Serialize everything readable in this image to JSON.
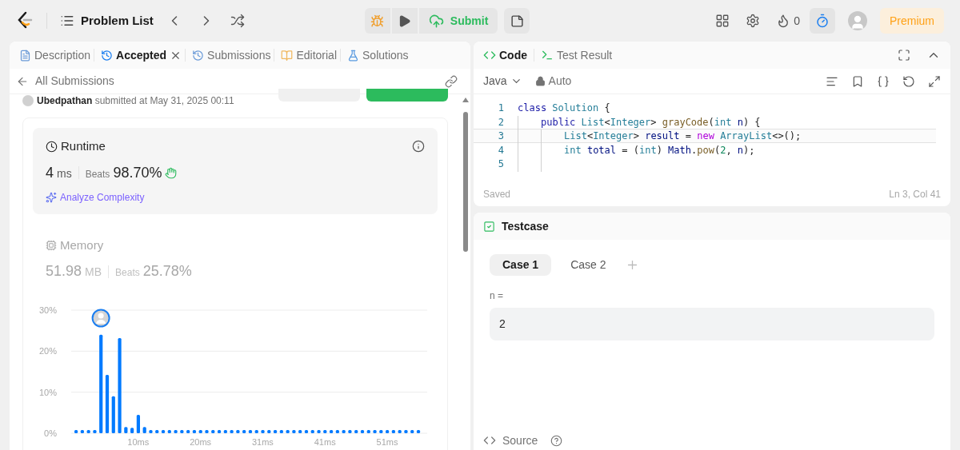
{
  "toolbar": {
    "title": "Problem List",
    "submit_label": "Submit",
    "streak": "0",
    "premium": "Premium",
    "timer_active": true
  },
  "left_tabs": [
    {
      "label": "Description",
      "selected": false,
      "closable": false
    },
    {
      "label": "Accepted",
      "selected": true,
      "closable": true
    },
    {
      "label": "Submissions",
      "selected": false,
      "closable": false
    },
    {
      "label": "Editorial",
      "selected": false,
      "closable": false
    },
    {
      "label": "Solutions",
      "selected": false,
      "closable": false
    }
  ],
  "submission": {
    "back_label": "All Submissions",
    "user": "Ubedpathan",
    "submitted_text": "submitted at May 31, 2025 00:11"
  },
  "runtime": {
    "title": "Runtime",
    "value": "4",
    "unit": "ms",
    "beats_label": "Beats",
    "beats": "98.70%",
    "analyze": "Analyze Complexity",
    "selected": true
  },
  "memory": {
    "title": "Memory",
    "value": "51.98",
    "unit": "MB",
    "beats_label": "Beats",
    "beats": "25.78%",
    "selected": false
  },
  "chart_data": {
    "type": "bar",
    "categories": [
      null,
      null,
      null,
      null,
      null,
      null,
      null,
      null,
      null,
      null,
      "10ms",
      null,
      null,
      null,
      null,
      null,
      null,
      null,
      null,
      null,
      "20ms",
      null,
      null,
      null,
      null,
      null,
      null,
      null,
      null,
      null,
      "31ms",
      null,
      null,
      null,
      null,
      null,
      null,
      null,
      null,
      null,
      "41ms",
      null,
      null,
      null,
      null,
      null,
      null,
      null,
      null,
      null,
      "51ms",
      null,
      null,
      null,
      null,
      null
    ],
    "values": [
      0.8,
      0.8,
      0.8,
      0.8,
      24,
      14.2,
      9,
      23.2,
      1.5,
      1.3,
      4.5,
      1.5,
      0.8,
      0.8,
      0.8,
      0.8,
      0.8,
      0.8,
      0.8,
      0.8,
      0.8,
      0.8,
      0.8,
      0.8,
      0.8,
      0.8,
      0.8,
      0.8,
      0.8,
      0.8,
      0.8,
      0.8,
      0.8,
      0.8,
      0.8,
      0.8,
      0.8,
      0.8,
      0.8,
      0.8,
      0.8,
      0.8,
      0.8,
      0.8,
      0.8,
      0.8,
      0.8,
      0.8,
      0.8,
      0.8,
      0.8,
      0.8,
      0.8,
      0.8,
      0.8,
      0.8
    ],
    "yticks": [
      {
        "value": 0,
        "label": "0%"
      },
      {
        "value": 10,
        "label": "10%"
      },
      {
        "value": 20,
        "label": "20%"
      },
      {
        "value": 30,
        "label": "30%"
      }
    ],
    "ylim": [
      0,
      30
    ]
  },
  "code_tabs": [
    {
      "label": "Code",
      "selected": true
    },
    {
      "label": "Test Result",
      "selected": false
    }
  ],
  "editor": {
    "language": "Java",
    "mode": "Auto",
    "status": "Saved",
    "position": "Ln 3, Col 41",
    "lines": [
      {
        "number": "1",
        "current": false,
        "tokens": [
          {
            "text": "class ",
            "kind": "keyword"
          },
          {
            "text": "Solution",
            "kind": "type"
          },
          {
            "text": " {",
            "kind": "plain"
          }
        ],
        "children": [
          {
            "number": "2",
            "current": false,
            "tokens": [
              {
                "text": "public ",
                "kind": "keyword"
              },
              {
                "text": "List",
                "kind": "type"
              },
              {
                "text": "<",
                "kind": "plain"
              },
              {
                "text": "Integer",
                "kind": "type"
              },
              {
                "text": "> ",
                "kind": "plain"
              },
              {
                "text": "grayCode",
                "kind": "method"
              },
              {
                "text": "(",
                "kind": "plain"
              },
              {
                "text": "int ",
                "kind": "type"
              },
              {
                "text": "n",
                "kind": "variable"
              },
              {
                "text": ") {",
                "kind": "plain"
              }
            ],
            "children": [
              {
                "number": "3",
                "current": true,
                "tokens": [
                  {
                    "text": "List",
                    "kind": "type"
                  },
                  {
                    "text": "<",
                    "kind": "plain"
                  },
                  {
                    "text": "Integer",
                    "kind": "type"
                  },
                  {
                    "text": "> ",
                    "kind": "plain"
                  },
                  {
                    "text": "result",
                    "kind": "variable"
                  },
                  {
                    "text": " = ",
                    "kind": "plain"
                  },
                  {
                    "text": "new ",
                    "kind": "control"
                  },
                  {
                    "text": "ArrayList",
                    "kind": "type"
                  },
                  {
                    "text": "<>();",
                    "kind": "plain"
                  }
                ]
              },
              {
                "number": "4",
                "current": false,
                "tokens": [
                  {
                    "text": "int ",
                    "kind": "type"
                  },
                  {
                    "text": "total",
                    "kind": "variable"
                  },
                  {
                    "text": " = (",
                    "kind": "plain"
                  },
                  {
                    "text": "int",
                    "kind": "type"
                  },
                  {
                    "text": ") ",
                    "kind": "plain"
                  },
                  {
                    "text": "Math",
                    "kind": "variable"
                  },
                  {
                    "text": ".",
                    "kind": "plain"
                  },
                  {
                    "text": "pow",
                    "kind": "method"
                  },
                  {
                    "text": "(",
                    "kind": "plain"
                  },
                  {
                    "text": "2",
                    "kind": "number"
                  },
                  {
                    "text": ", ",
                    "kind": "plain"
                  },
                  {
                    "text": "n",
                    "kind": "variable"
                  },
                  {
                    "text": ");",
                    "kind": "plain"
                  }
                ]
              },
              {
                "number": "5",
                "current": false
              }
            ]
          }
        ]
      }
    ]
  },
  "testcase": {
    "title": "Testcase",
    "cases": [
      {
        "label": "Case 1",
        "selected": true
      },
      {
        "label": "Case 2",
        "selected": false
      }
    ],
    "param_label": "n =",
    "param_value": "2",
    "source_label": "Source"
  }
}
